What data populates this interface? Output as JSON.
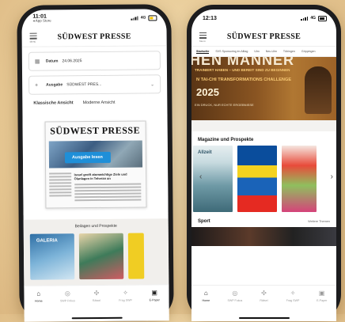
{
  "left_phone": {
    "status": {
      "time": "11:01",
      "back_app": "◂ App Store",
      "network": "4G"
    },
    "appbar": {
      "menu_label": "Menü",
      "logo": "SÜDWEST PRESSE"
    },
    "date_card": {
      "label": "Datum",
      "value": "24.06.2025",
      "icon": "calendar-icon"
    },
    "edition_card": {
      "label": "Ausgabe",
      "value": "SÜDWEST PRES...",
      "icon": "location-pin-icon"
    },
    "views": {
      "classic": "Klassische Ansicht",
      "modern": "Moderne Ansicht"
    },
    "paper": {
      "masthead": "SÜDWEST PRESSE",
      "read_button": "Ausgabe lesen",
      "headline": "Israel greift atomwichtige Ziele und Ölanlagen in Teheran an"
    },
    "beilagen": {
      "title": "Beilagen und Prospekte",
      "thumb1": "GALERIA"
    },
    "tabbar": [
      {
        "label": "Home",
        "icon": "home-icon",
        "active": true
      },
      {
        "label": "SWP Fokus",
        "icon": "focus-icon",
        "active": false
      },
      {
        "label": "Rätsel",
        "icon": "puzzle-icon",
        "active": false
      },
      {
        "label": "Frag SWP",
        "icon": "ask-icon",
        "active": false
      },
      {
        "label": "E-Paper",
        "icon": "epaper-icon",
        "active": false
      }
    ]
  },
  "right_phone": {
    "status": {
      "time": "12:13",
      "network": "4G"
    },
    "appbar": {
      "menu_label": "Menü",
      "logo": "SÜDWEST PRESSE"
    },
    "ressorts": [
      "Startseite",
      "SVS Sponsoring im Alltag",
      "Ulm",
      "Neu-Ulm",
      "Tübingen",
      "Göppingen"
    ],
    "promo": {
      "line1": "HEN MÄNNER",
      "line2": "TRAINIERT HABEN – UND BEREIT SIND ZU BEGINNEN",
      "line3": "N TAI-CHI TRANSFORMATIONS CHALLENGE",
      "year": "2025",
      "line5": "EIN DRUCK, NUR ECHTE ERGEBNISSE"
    },
    "magazines": {
      "title": "Magazine und Prospekte",
      "mag1": "Allzeit"
    },
    "sport": {
      "title": "Sport",
      "link": "Weitere Themen"
    },
    "tabbar": [
      {
        "label": "Home",
        "icon": "home-icon",
        "active": true
      },
      {
        "label": "SWP Fokus",
        "icon": "focus-icon",
        "active": false
      },
      {
        "label": "Rätsel",
        "icon": "puzzle-icon",
        "active": false
      },
      {
        "label": "Frag SWP",
        "icon": "ask-icon",
        "active": false
      },
      {
        "label": "E-Paper",
        "icon": "epaper-icon",
        "active": false
      }
    ]
  }
}
